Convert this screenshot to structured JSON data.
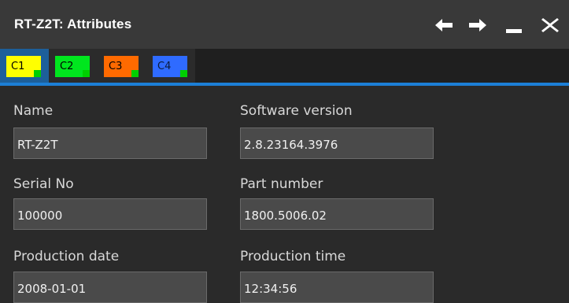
{
  "window": {
    "title": "RT-Z2T: Attributes",
    "buttons": [
      "back-arrow-icon",
      "forward-arrow-icon",
      "minimize-icon",
      "close-icon"
    ]
  },
  "tabs": [
    {
      "label": "C1",
      "color": "#ffff00",
      "indicator_color": "#00d000",
      "active": true
    },
    {
      "label": "C2",
      "color": "#00e61e",
      "indicator_color": "#00d000",
      "active": false
    },
    {
      "label": "C3",
      "color": "#ff6a00",
      "indicator_color": "#00d000",
      "active": false
    },
    {
      "label": "C4",
      "color": "#2f6bff",
      "indicator_color": "#00d000",
      "active": false
    }
  ],
  "fields": {
    "name": {
      "label": "Name",
      "value": "RT-Z2T"
    },
    "software_version": {
      "label": "Software version",
      "value": "2.8.23164.3976"
    },
    "serial_no": {
      "label": "Serial No",
      "value": "100000"
    },
    "part_number": {
      "label": "Part number",
      "value": "1800.5006.02"
    },
    "production_date": {
      "label": "Production date",
      "value": "2008-01-01"
    },
    "production_time": {
      "label": "Production time",
      "value": "12:34:56"
    }
  },
  "colors": {
    "accent": "#1c7fd6",
    "background": "#2a2a2a",
    "titlebar": "#393939"
  }
}
